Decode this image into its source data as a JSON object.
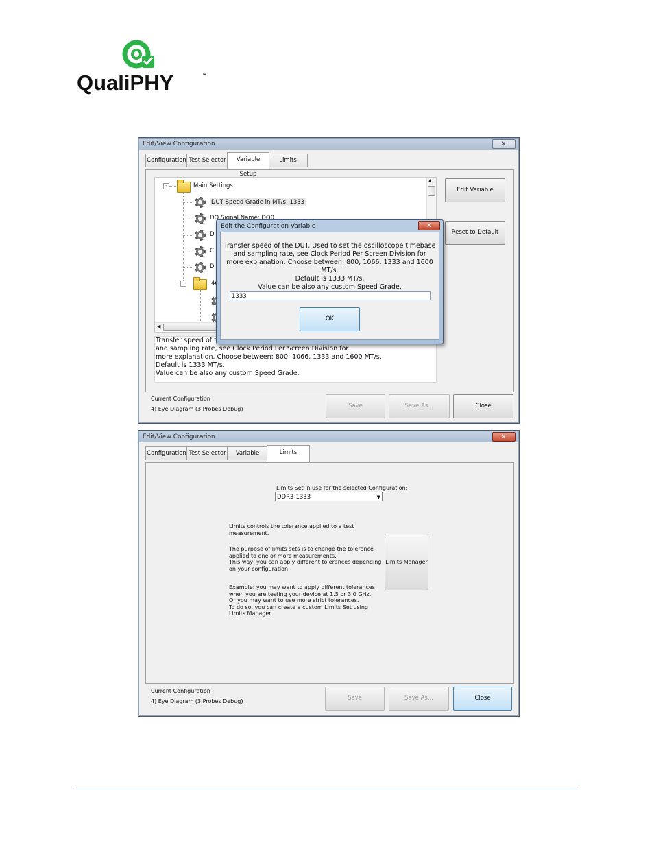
{
  "logo": {
    "text": "QualiPHY",
    "tm": "™"
  },
  "window1": {
    "title": "Edit/View Configuration",
    "close": "x",
    "tabs": [
      "Configuration",
      "Test Selector",
      "Variable Setup",
      "Limits"
    ],
    "selected_tab": "Variable Setup",
    "tree": {
      "root": "Main Settings",
      "items": [
        "DUT Speed Grade in MT/s: 1333",
        "DQ Signal Name: DQ0",
        "D",
        "C",
        "D"
      ],
      "folder2_prefix": "4c"
    },
    "buttons": {
      "edit_variable": "Edit Variable",
      "reset": "Reset to Default"
    },
    "description": [
      "Transfer speed of the DUT. Used to set the oscilloscope timebase",
      "and sampling rate, see Clock Period Per Screen Division for",
      "more explanation. Choose between: 800, 1066, 1333 and 1600 MT/s.",
      "Default is 1333 MT/s.",
      "Value can be also any custom Speed Grade."
    ],
    "footer": {
      "current_label": "Current Configuration :",
      "current_value": "4) Eye Diagram (3 Probes Debug)",
      "save": "Save",
      "save_as": "Save As...",
      "close": "Close"
    },
    "dialog": {
      "title": "Edit the Configuration Variable",
      "close": "x",
      "text": [
        "Transfer speed of the DUT. Used to set the oscilloscope timebase",
        "and sampling rate, see Clock Period Per Screen Division for",
        "more explanation. Choose between: 800, 1066, 1333 and 1600 MT/s.",
        "Default is 1333 MT/s.",
        "Value can be also any custom Speed Grade."
      ],
      "value": "1333",
      "ok": "OK"
    }
  },
  "window2": {
    "title": "Edit/View Configuration",
    "close": "x",
    "tabs": [
      "Configuration",
      "Test Selector",
      "Variable Setup",
      "Limits"
    ],
    "selected_tab": "Limits",
    "limits_label": "Limits Set in use for the selected Configuration:",
    "limits_value": "DDR3-1333",
    "para1": [
      "Limits controls the tolerance applied to a test",
      "measurement."
    ],
    "para2": [
      "The purpose of limits sets is to change the tolerance",
      "applied to one or more measurements.",
      "This way, you can apply different tolerances depending",
      "on your configuration."
    ],
    "para3": [
      "Example: you may want to apply different tolerances",
      "when you are testing your device at 1.5 or 3.0 GHz.",
      "Or you may want to use more strict tolerances.",
      "To do so, you can create a custom Limits Set using",
      "Limits Manager."
    ],
    "limits_manager": "Limits Manager",
    "footer": {
      "current_label": "Current Configuration :",
      "current_value": "4) Eye Diagram (3 Probes Debug)",
      "save": "Save",
      "save_as": "Save As...",
      "close": "Close"
    }
  },
  "colors": {
    "accent_green": "#2db24a",
    "title_bar": "#b7c7db",
    "rule": "#2a4d7a"
  }
}
